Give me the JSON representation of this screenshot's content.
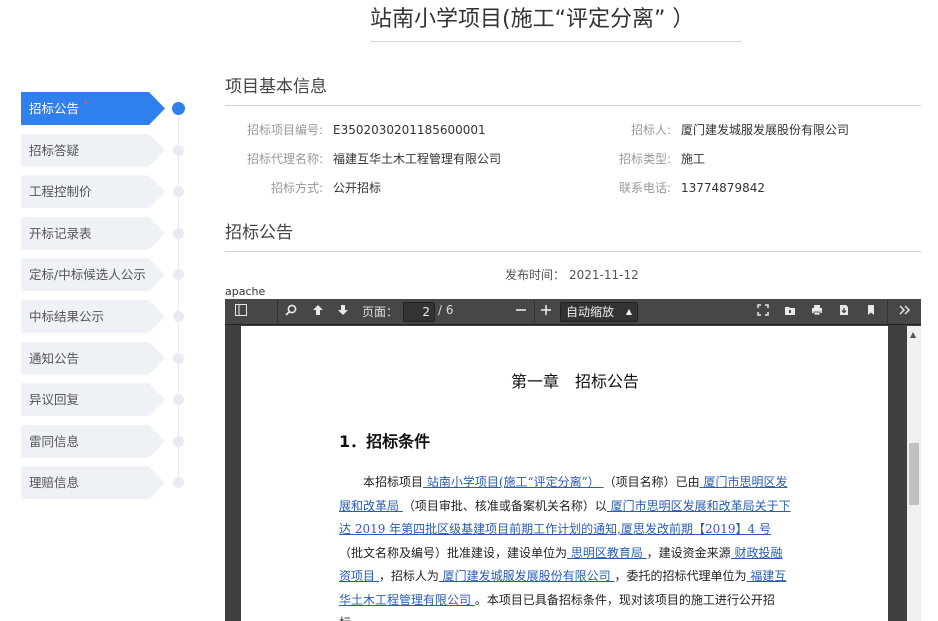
{
  "page": {
    "title": "站南小学项目(施工“评定分离” ）"
  },
  "sidebar": {
    "items": [
      {
        "label": "招标公告",
        "marker": "•"
      },
      {
        "label": "招标答疑"
      },
      {
        "label": "工程控制价"
      },
      {
        "label": "开标记录表"
      },
      {
        "label": "定标/中标候选人公示"
      },
      {
        "label": "中标结果公示"
      },
      {
        "label": "通知公告"
      },
      {
        "label": "异议回复"
      },
      {
        "label": "雷同信息"
      },
      {
        "label": "理赔信息"
      }
    ],
    "active_index": 0,
    "active_color": "#2f80ed"
  },
  "basic_info": {
    "heading": "项目基本信息",
    "fields": [
      {
        "label": "招标项目编号:",
        "value": "E3502030201185600001"
      },
      {
        "label": "招标人:",
        "value": "厦门建发城服发展股份有限公司"
      },
      {
        "label": "招标代理名称:",
        "value": "福建互华土木工程管理有限公司"
      },
      {
        "label": "招标类型:",
        "value": "施工"
      },
      {
        "label": "招标方式:",
        "value": "公开招标"
      },
      {
        "label": "联系电话:",
        "value": "13774879842"
      }
    ]
  },
  "notice": {
    "heading": "招标公告",
    "publish_label": "发布时间：",
    "publish_date": "2021-11-12"
  },
  "viewer": {
    "apache_text": "apache",
    "page_label": "页面：",
    "current_page": "2",
    "total_pages": "/ 6",
    "zoom": "自动缩放",
    "icons": {
      "sidebar_toggle": "sidebar-toggle-icon",
      "search": "search-icon",
      "prev": "arrow-up-icon",
      "next": "arrow-down-icon",
      "zoom_out": "minus-icon",
      "zoom_in": "plus-icon",
      "fullscreen": "fullscreen-icon",
      "open": "open-file-icon",
      "print": "print-icon",
      "download": "download-icon",
      "bookmark": "bookmark-icon",
      "more": "double-chevron-right-icon"
    }
  },
  "document": {
    "chapter": "第一章　招标公告",
    "section": "1．招标条件",
    "paragraph": [
      {
        "t": "　　本招标项目"
      },
      {
        "t": "  站南小学项目(施工“评定分离”） ",
        "link": true
      },
      {
        "t": "（项目名称）已由"
      },
      {
        "t": "  厦门市思明区发展和改革局  ",
        "link": true
      },
      {
        "t": "（项目审批、核准或备案机关名称）以"
      },
      {
        "t": "  厦门市思明区发展和改革局关于下达 2019 年第四批区级基建项目前期工作计划的通知,厦思发改前期【2019】4 号  ",
        "link": true
      },
      {
        "t": "（批文名称及编号）批准建设，建设单位为"
      },
      {
        "t": "  思明区教育局  ",
        "link": true
      },
      {
        "t": "，建设资金来源"
      },
      {
        "t": "  财政投融资项目  ",
        "link": true
      },
      {
        "t": "，招标人为"
      },
      {
        "t": "  厦门建发城服发展股份有限公司  ",
        "link": true
      },
      {
        "t": "，委托的招标代理单位为"
      },
      {
        "t": "  福建互华土木工程管理有限公司  ",
        "link": true
      },
      {
        "t": "。本项目已具备招标条件，现对该项目的施工进行公开招标。"
      }
    ]
  }
}
